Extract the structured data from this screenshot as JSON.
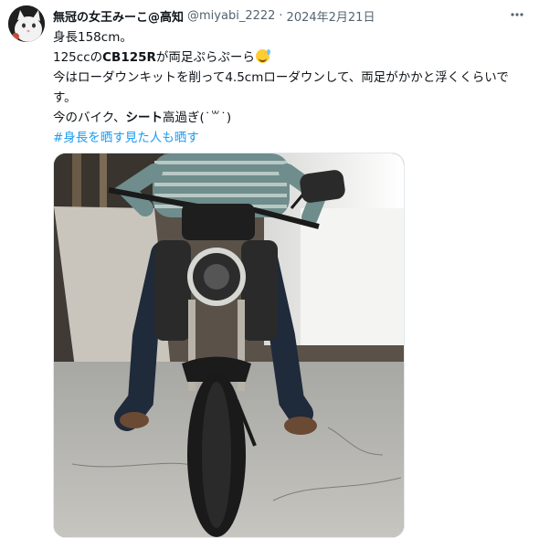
{
  "post": {
    "author": {
      "display_name": "無冠の女王みーこ@高知",
      "handle": "@miyabi_2222",
      "avatar_icon": "cat-avatar-icon"
    },
    "separator": "·",
    "date": "2024年2月21日",
    "more_icon": "more-horizontal-icon",
    "lines": {
      "l1": "身長158cm。",
      "l2_a": "125ccの",
      "l2_b": "CB125R",
      "l2_c": "が両足ぷらぷーら",
      "l3": "今はローダウンキットを削って4.5cmローダウンして、両足がかかと浮くくらいです。",
      "l4_a": "今のバイク、",
      "l4_b": "シート",
      "l4_c": "高過ぎ(˙꒳˙)"
    },
    "hashtag": "#身長を晒す見た人も晒す",
    "emoji": "sweat-smile-emoji",
    "media": {
      "description_icon": "motorcycle-photo"
    }
  },
  "colors": {
    "text": "#0f1419",
    "secondary": "#536471",
    "link": "#1d9bf0",
    "border": "#e1e8ed"
  }
}
